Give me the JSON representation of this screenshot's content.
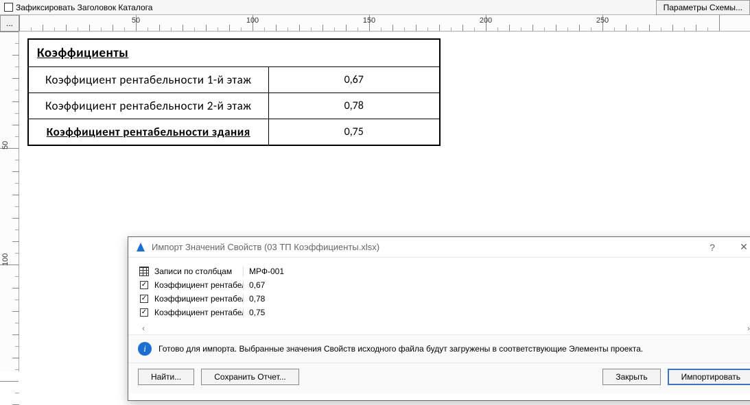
{
  "topbar": {
    "fix_header_label": "Зафиксировать Заголовок Каталога",
    "scheme_params_label": "Параметры Схемы..."
  },
  "ruler": {
    "corner_label": "...",
    "h_labels": [
      "50",
      "100",
      "150",
      "200",
      "250"
    ],
    "v_labels": [
      "50",
      "100"
    ]
  },
  "schedule": {
    "title": "Коэффициенты",
    "rows": [
      {
        "label": "Коэффициент рентабельности 1-й этаж",
        "value": "0,67"
      },
      {
        "label": "Коэффициент рентабельности 2-й этаж",
        "value": "0,78"
      }
    ],
    "footer": {
      "label": "Коэффициент рентабельности здания",
      "value": "0,75"
    }
  },
  "dialog": {
    "title": "Импорт Значений Свойств (03 ТП Коэффициенты.xlsx)",
    "help": "?",
    "columns_header": "Записи по столбцам",
    "id_header": "МРФ-001",
    "rows": [
      {
        "label": "Коэффициент рентабел",
        "value": "0,67"
      },
      {
        "label": "Коэффициент рентабел",
        "value": "0,78"
      },
      {
        "label": "Коэффициент рентабел",
        "value": "0,75"
      }
    ],
    "scroll_left": "‹",
    "scroll_right": "›",
    "status": "Готово для импорта. Выбранные значения Свойств исходного файла будут загружены в соответствующие Элементы проекта.",
    "buttons": {
      "find": "Найти...",
      "save_report": "Сохранить Отчет...",
      "close": "Закрыть",
      "import": "Импортировать"
    }
  }
}
